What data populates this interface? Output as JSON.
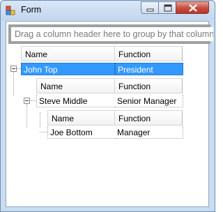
{
  "window": {
    "title": "Form",
    "controls": [
      "minimize-icon",
      "maximize-icon",
      "close-icon"
    ]
  },
  "group_panel": {
    "text": "Drag a column header here to group by that column"
  },
  "colors": {
    "selected_row": "#3399ff",
    "group_panel_border": "#a0a0a0",
    "close_button": "#c75044"
  },
  "grid": {
    "levels": [
      {
        "columns": [
          "Name",
          "Function"
        ],
        "row": {
          "name": "John Top",
          "function": "President",
          "expanded": true,
          "selected": true
        }
      },
      {
        "columns": [
          "Name",
          "Function"
        ],
        "row": {
          "name": "Steve Middle",
          "function": "Senior Manager",
          "expanded": true,
          "selected": false
        }
      },
      {
        "columns": [
          "Name",
          "Function"
        ],
        "row": {
          "name": "Joe Bottom",
          "function": "Manager",
          "expanded": false,
          "selected": false
        }
      }
    ]
  }
}
